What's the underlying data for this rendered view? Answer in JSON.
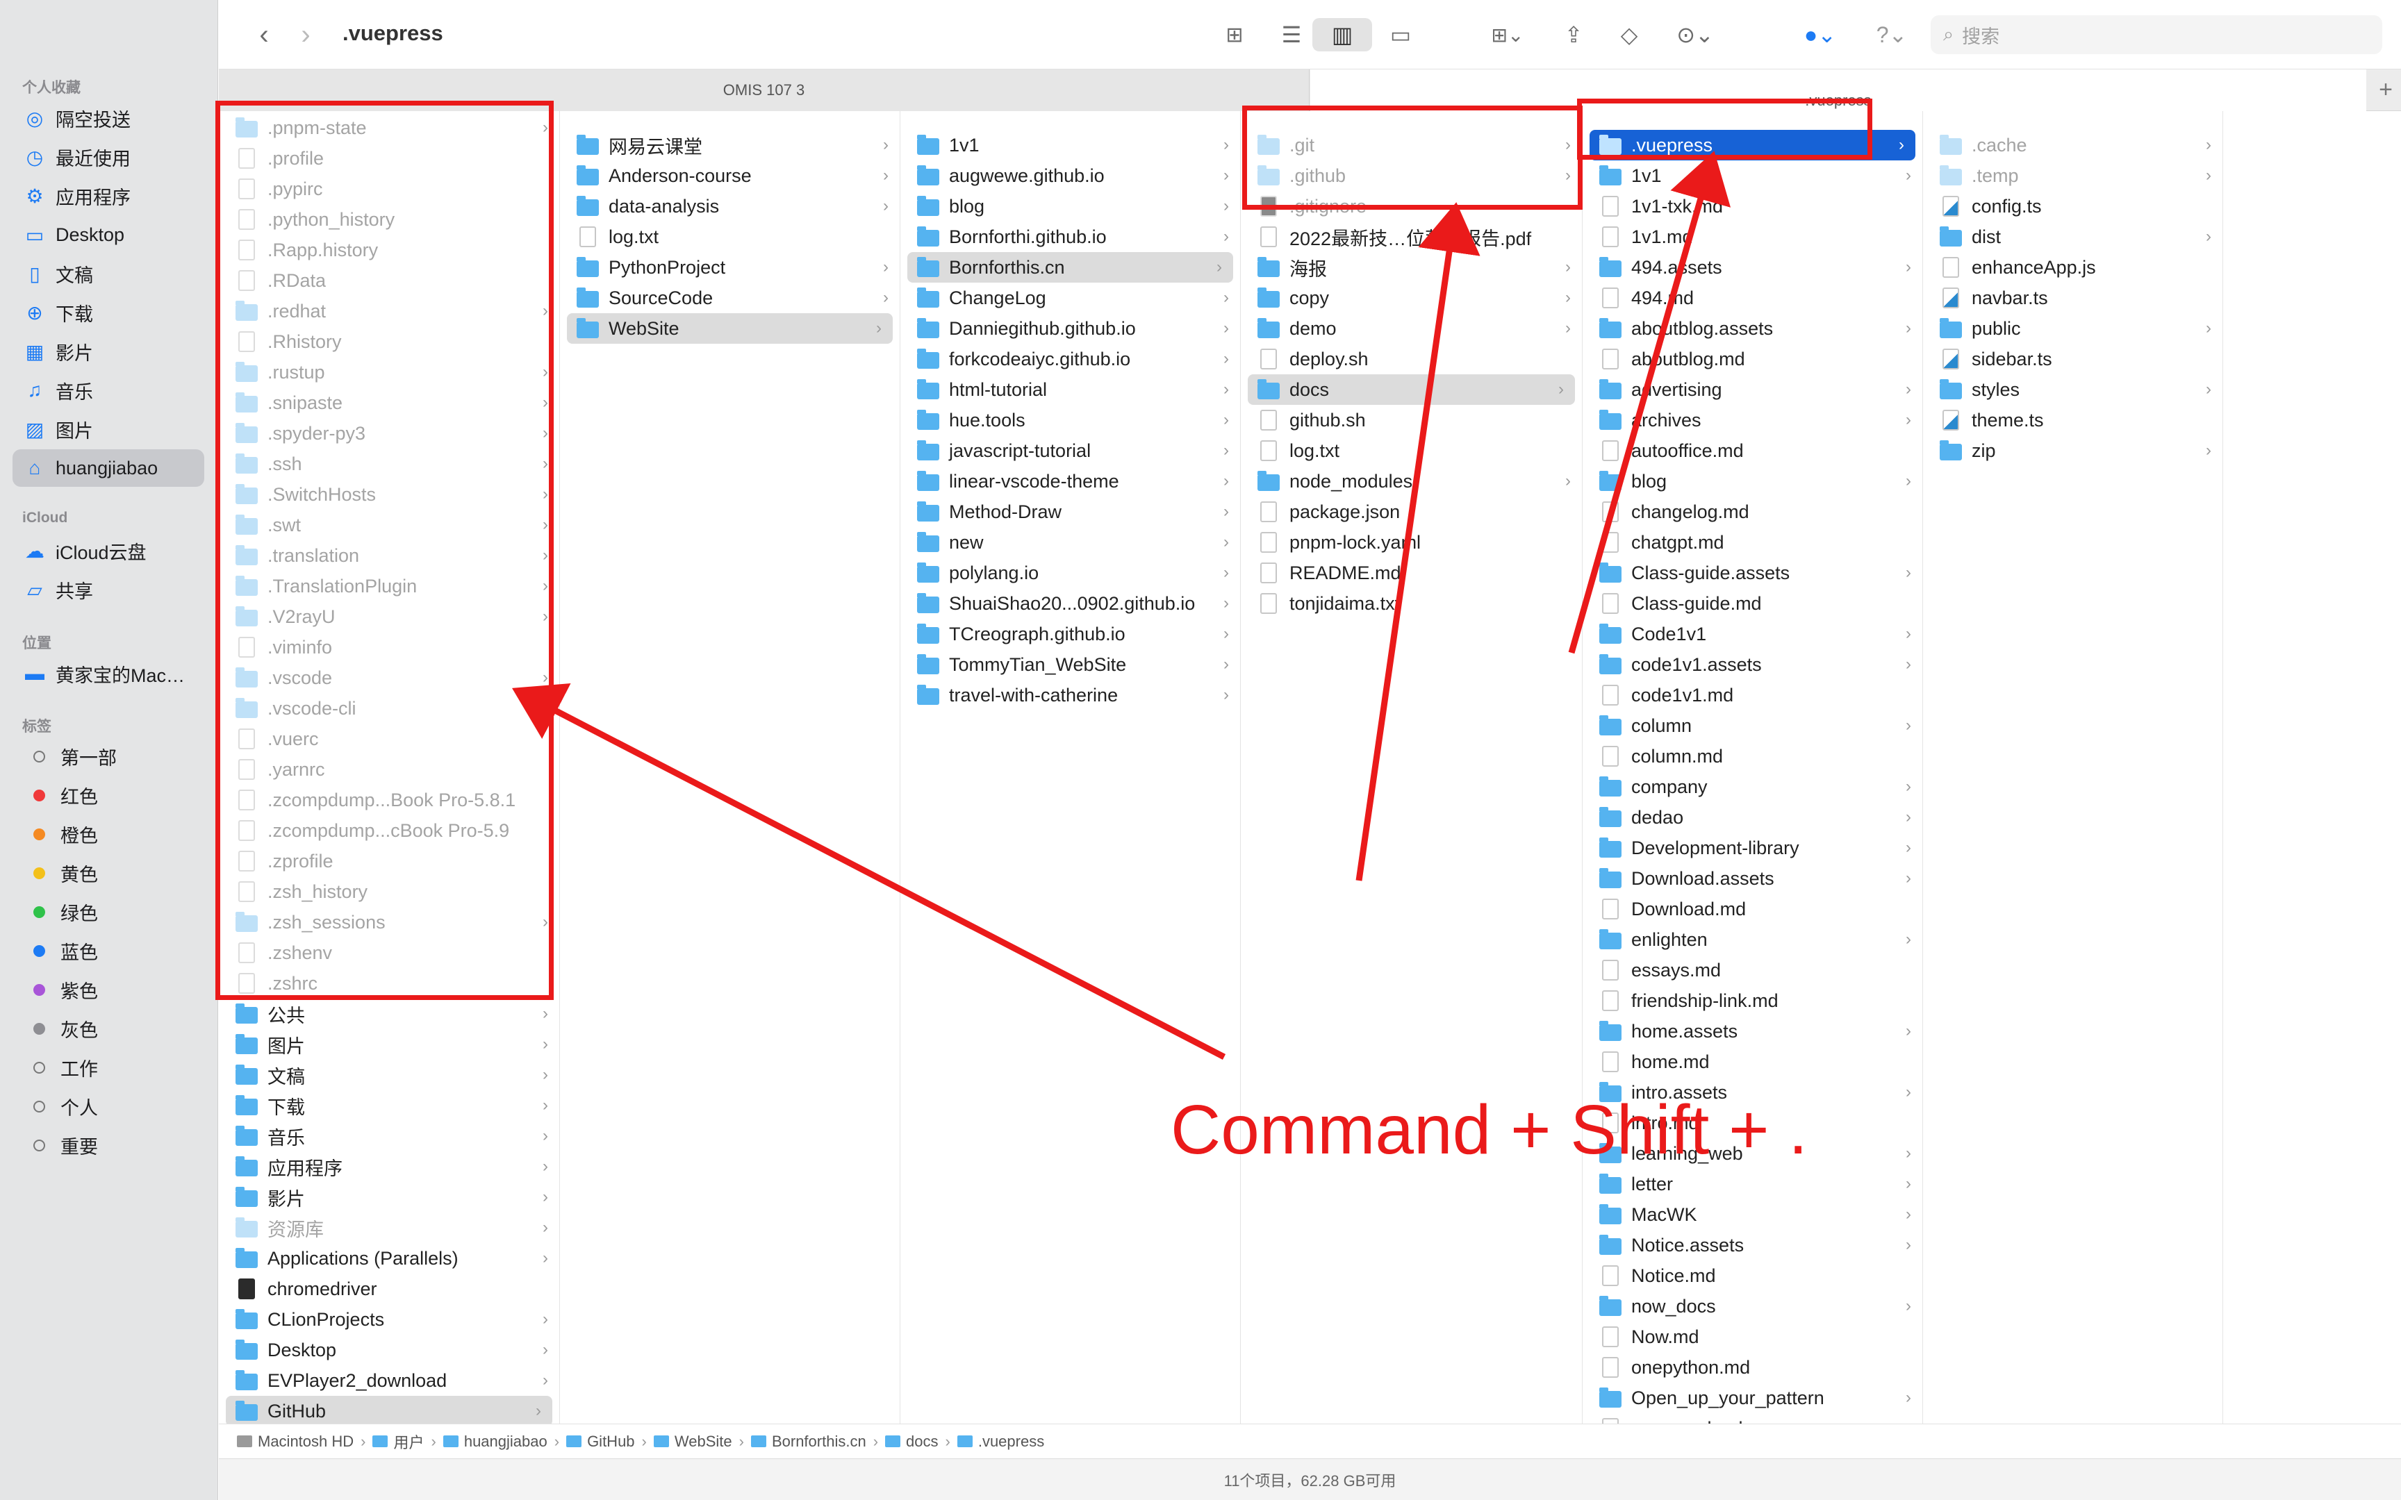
{
  "window": {
    "title": ".vuepress"
  },
  "search": {
    "placeholder": "搜索"
  },
  "tabs": [
    "OMIS 107 3",
    ".vuepress"
  ],
  "sidebar": {
    "favorites_heading": "个人收藏",
    "favorites": [
      {
        "label": "隔空投送",
        "icon": "airdrop-icon"
      },
      {
        "label": "最近使用",
        "icon": "clock-icon"
      },
      {
        "label": "应用程序",
        "icon": "applications-icon"
      },
      {
        "label": "Desktop",
        "icon": "desktop-icon"
      },
      {
        "label": "文稿",
        "icon": "document-icon"
      },
      {
        "label": "下载",
        "icon": "download-icon"
      },
      {
        "label": "影片",
        "icon": "film-icon"
      },
      {
        "label": "音乐",
        "icon": "music-icon"
      },
      {
        "label": "图片",
        "icon": "photo-icon"
      },
      {
        "label": "huangjiabao",
        "icon": "home-icon"
      }
    ],
    "icloud_heading": "iCloud",
    "icloud": [
      {
        "label": "iCloud云盘",
        "icon": "cloud-icon"
      },
      {
        "label": "共享",
        "icon": "shared-folder-icon"
      }
    ],
    "locations_heading": "位置",
    "locations": [
      {
        "label": "黄家宝的Mac…",
        "icon": "laptop-icon"
      }
    ],
    "tags_heading": "标签",
    "tags": [
      {
        "label": "第一部",
        "color": "hollow"
      },
      {
        "label": "红色",
        "color": "#f0393a"
      },
      {
        "label": "橙色",
        "color": "#f58a22"
      },
      {
        "label": "黄色",
        "color": "#f3c01a"
      },
      {
        "label": "绿色",
        "color": "#2fc24a"
      },
      {
        "label": "蓝色",
        "color": "#1d7bf4"
      },
      {
        "label": "紫色",
        "color": "#a855d8"
      },
      {
        "label": "灰色",
        "color": "#8e8e93"
      },
      {
        "label": "工作",
        "color": "hollow"
      },
      {
        "label": "个人",
        "color": "hollow"
      },
      {
        "label": "重要",
        "color": "hollow"
      }
    ]
  },
  "columns": [
    [
      {
        "n": ".pnpm-state",
        "t": "folder",
        "h": true,
        "c": true
      },
      {
        "n": ".profile",
        "t": "file",
        "h": true
      },
      {
        "n": ".pypirc",
        "t": "file",
        "h": true
      },
      {
        "n": ".python_history",
        "t": "file",
        "h": true
      },
      {
        "n": ".Rapp.history",
        "t": "file",
        "h": true
      },
      {
        "n": ".RData",
        "t": "file",
        "h": true
      },
      {
        "n": ".redhat",
        "t": "folder",
        "h": true,
        "c": true
      },
      {
        "n": ".Rhistory",
        "t": "file",
        "h": true
      },
      {
        "n": ".rustup",
        "t": "folder",
        "h": true,
        "c": true
      },
      {
        "n": ".snipaste",
        "t": "folder",
        "h": true,
        "c": true
      },
      {
        "n": ".spyder-py3",
        "t": "folder",
        "h": true,
        "c": true
      },
      {
        "n": ".ssh",
        "t": "folder",
        "h": true,
        "c": true
      },
      {
        "n": ".SwitchHosts",
        "t": "folder",
        "h": true,
        "c": true
      },
      {
        "n": ".swt",
        "t": "folder",
        "h": true,
        "c": true
      },
      {
        "n": ".translation",
        "t": "folder",
        "h": true,
        "c": true
      },
      {
        "n": ".TranslationPlugin",
        "t": "folder",
        "h": true,
        "c": true
      },
      {
        "n": ".V2rayU",
        "t": "folder",
        "h": true,
        "c": true
      },
      {
        "n": ".viminfo",
        "t": "file",
        "h": true
      },
      {
        "n": ".vscode",
        "t": "folder",
        "h": true,
        "c": true
      },
      {
        "n": ".vscode-cli",
        "t": "folder",
        "h": true,
        "c": true
      },
      {
        "n": ".vuerc",
        "t": "file",
        "h": true
      },
      {
        "n": ".yarnrc",
        "t": "file",
        "h": true
      },
      {
        "n": ".zcompdump...Book Pro-5.8.1",
        "t": "file",
        "h": true
      },
      {
        "n": ".zcompdump...cBook Pro-5.9",
        "t": "file",
        "h": true
      },
      {
        "n": ".zprofile",
        "t": "file",
        "h": true
      },
      {
        "n": ".zsh_history",
        "t": "file",
        "h": true
      },
      {
        "n": ".zsh_sessions",
        "t": "folder",
        "h": true,
        "c": true
      },
      {
        "n": ".zshenv",
        "t": "file",
        "h": true
      },
      {
        "n": ".zshrc",
        "t": "file",
        "h": true
      },
      {
        "n": "公共",
        "t": "folder",
        "c": true
      },
      {
        "n": "图片",
        "t": "folder",
        "c": true
      },
      {
        "n": "文稿",
        "t": "folder",
        "c": true
      },
      {
        "n": "下载",
        "t": "folder",
        "c": true
      },
      {
        "n": "音乐",
        "t": "folder",
        "c": true
      },
      {
        "n": "应用程序",
        "t": "folder",
        "c": true
      },
      {
        "n": "影片",
        "t": "folder",
        "c": true
      },
      {
        "n": "资源库",
        "t": "folder",
        "h": true,
        "c": true
      },
      {
        "n": "Applications (Parallels)",
        "t": "folder",
        "c": true
      },
      {
        "n": "chromedriver",
        "t": "dark"
      },
      {
        "n": "CLionProjects",
        "t": "folder",
        "c": true
      },
      {
        "n": "Desktop",
        "t": "folder",
        "c": true
      },
      {
        "n": "EVPlayer2_download",
        "t": "folder",
        "c": true
      },
      {
        "n": "GitHub",
        "t": "folder",
        "c": true,
        "s": "hl"
      }
    ],
    [
      {
        "n": "网易云课堂",
        "t": "folder",
        "c": true
      },
      {
        "n": "Anderson-course",
        "t": "folder",
        "c": true
      },
      {
        "n": "data-analysis",
        "t": "folder",
        "c": true
      },
      {
        "n": "log.txt",
        "t": "file"
      },
      {
        "n": "PythonProject",
        "t": "folder",
        "c": true
      },
      {
        "n": "SourceCode",
        "t": "folder",
        "c": true
      },
      {
        "n": "WebSite",
        "t": "folder",
        "c": true,
        "s": "hl"
      }
    ],
    [
      {
        "n": "1v1",
        "t": "folder",
        "c": true
      },
      {
        "n": "augwewe.github.io",
        "t": "folder",
        "c": true
      },
      {
        "n": "blog",
        "t": "folder",
        "c": true
      },
      {
        "n": "Bornforthi.github.io",
        "t": "folder",
        "c": true
      },
      {
        "n": "Bornforthis.cn",
        "t": "folder",
        "c": true,
        "s": "hl"
      },
      {
        "n": "ChangeLog",
        "t": "folder",
        "c": true
      },
      {
        "n": "Danniegithub.github.io",
        "t": "folder",
        "c": true
      },
      {
        "n": "forkcodeaiyc.github.io",
        "t": "folder",
        "c": true
      },
      {
        "n": "html-tutorial",
        "t": "folder",
        "c": true
      },
      {
        "n": "hue.tools",
        "t": "folder",
        "c": true
      },
      {
        "n": "javascript-tutorial",
        "t": "folder",
        "c": true
      },
      {
        "n": "linear-vscode-theme",
        "t": "folder",
        "c": true
      },
      {
        "n": "Method-Draw",
        "t": "folder",
        "c": true
      },
      {
        "n": "new",
        "t": "folder",
        "c": true
      },
      {
        "n": "polylang.io",
        "t": "folder",
        "c": true
      },
      {
        "n": "ShuaiShao20...0902.github.io",
        "t": "folder",
        "c": true
      },
      {
        "n": "TCreograph.github.io",
        "t": "folder",
        "c": true
      },
      {
        "n": "TommyTian_WebSite",
        "t": "folder",
        "c": true
      },
      {
        "n": "travel-with-catherine",
        "t": "folder",
        "c": true
      }
    ],
    [
      {
        "n": ".git",
        "t": "folder",
        "h": true,
        "c": true
      },
      {
        "n": ".github",
        "t": "folder",
        "h": true,
        "c": true
      },
      {
        "n": ".gitignore",
        "t": "gray",
        "h": true
      },
      {
        "n": "2022最新技…位薪酬报告.pdf",
        "t": "file"
      },
      {
        "n": "海报",
        "t": "folder",
        "c": true
      },
      {
        "n": "copy",
        "t": "folder",
        "c": true
      },
      {
        "n": "demo",
        "t": "folder",
        "c": true
      },
      {
        "n": "deploy.sh",
        "t": "file"
      },
      {
        "n": "docs",
        "t": "folder",
        "c": true,
        "s": "hl"
      },
      {
        "n": "github.sh",
        "t": "file"
      },
      {
        "n": "log.txt",
        "t": "file"
      },
      {
        "n": "node_modules",
        "t": "folder",
        "c": true
      },
      {
        "n": "package.json",
        "t": "file"
      },
      {
        "n": "pnpm-lock.yaml",
        "t": "file"
      },
      {
        "n": "README.md",
        "t": "file"
      },
      {
        "n": "tonjidaima.txt",
        "t": "file"
      }
    ],
    [
      {
        "n": ".vuepress",
        "t": "folder",
        "h": true,
        "c": true,
        "s": "act"
      },
      {
        "n": "1v1",
        "t": "folder",
        "c": true
      },
      {
        "n": "1v1-txk.md",
        "t": "file"
      },
      {
        "n": "1v1.md",
        "t": "file"
      },
      {
        "n": "494.assets",
        "t": "folder",
        "c": true
      },
      {
        "n": "494.md",
        "t": "file"
      },
      {
        "n": "aboutblog.assets",
        "t": "folder",
        "c": true
      },
      {
        "n": "aboutblog.md",
        "t": "file"
      },
      {
        "n": "advertising",
        "t": "folder",
        "c": true
      },
      {
        "n": "archives",
        "t": "folder",
        "c": true
      },
      {
        "n": "autooffice.md",
        "t": "file"
      },
      {
        "n": "blog",
        "t": "folder",
        "c": true
      },
      {
        "n": "changelog.md",
        "t": "file"
      },
      {
        "n": "chatgpt.md",
        "t": "file"
      },
      {
        "n": "Class-guide.assets",
        "t": "folder",
        "c": true
      },
      {
        "n": "Class-guide.md",
        "t": "file"
      },
      {
        "n": "Code1v1",
        "t": "folder",
        "c": true
      },
      {
        "n": "code1v1.assets",
        "t": "folder",
        "c": true
      },
      {
        "n": "code1v1.md",
        "t": "file"
      },
      {
        "n": "column",
        "t": "folder",
        "c": true
      },
      {
        "n": "column.md",
        "t": "file"
      },
      {
        "n": "company",
        "t": "folder",
        "c": true
      },
      {
        "n": "dedao",
        "t": "folder",
        "c": true
      },
      {
        "n": "Development-library",
        "t": "folder",
        "c": true
      },
      {
        "n": "Download.assets",
        "t": "folder",
        "c": true
      },
      {
        "n": "Download.md",
        "t": "file"
      },
      {
        "n": "enlighten",
        "t": "folder",
        "c": true
      },
      {
        "n": "essays.md",
        "t": "file"
      },
      {
        "n": "friendship-link.md",
        "t": "file"
      },
      {
        "n": "home.assets",
        "t": "folder",
        "c": true
      },
      {
        "n": "home.md",
        "t": "file"
      },
      {
        "n": "intro.assets",
        "t": "folder",
        "c": true
      },
      {
        "n": "intro.md",
        "t": "file"
      },
      {
        "n": "learning_web",
        "t": "folder",
        "c": true
      },
      {
        "n": "letter",
        "t": "folder",
        "c": true
      },
      {
        "n": "MacWK",
        "t": "folder",
        "c": true
      },
      {
        "n": "Notice.assets",
        "t": "folder",
        "c": true
      },
      {
        "n": "Notice.md",
        "t": "file"
      },
      {
        "n": "now_docs",
        "t": "folder",
        "c": true
      },
      {
        "n": "Now.md",
        "t": "file"
      },
      {
        "n": "onepython.md",
        "t": "file"
      },
      {
        "n": "Open_up_your_pattern",
        "t": "folder",
        "c": true
      },
      {
        "n": "password.md",
        "t": "file"
      }
    ],
    [
      {
        "n": ".cache",
        "t": "folder",
        "h": true,
        "c": true
      },
      {
        "n": ".temp",
        "t": "folder",
        "h": true,
        "c": true
      },
      {
        "n": "config.ts",
        "t": "ts"
      },
      {
        "n": "dist",
        "t": "folder",
        "c": true
      },
      {
        "n": "enhanceApp.js",
        "t": "file"
      },
      {
        "n": "navbar.ts",
        "t": "ts"
      },
      {
        "n": "public",
        "t": "folder",
        "c": true
      },
      {
        "n": "sidebar.ts",
        "t": "ts"
      },
      {
        "n": "styles",
        "t": "folder",
        "c": true
      },
      {
        "n": "theme.ts",
        "t": "ts"
      },
      {
        "n": "zip",
        "t": "folder",
        "c": true
      }
    ]
  ],
  "pathbar": [
    "Macintosh HD",
    "用户",
    "huangjiabao",
    "GitHub",
    "WebSite",
    "Bornforthis.cn",
    "docs",
    ".vuepress"
  ],
  "status": "11个项目，62.28 GB可用",
  "annotation": {
    "shortcut_text": "Command + Shift + .",
    "color": "#ea1a1a"
  }
}
